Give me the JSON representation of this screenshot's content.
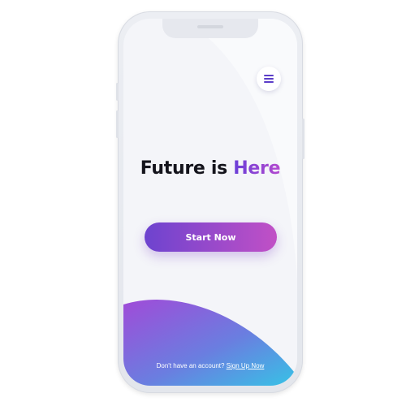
{
  "colors": {
    "accent_purple": "#6a3fd8",
    "accent_pink": "#c150c6",
    "wave_start": "#a04bd8",
    "wave_end": "#36c3e6",
    "headline_text": "#14141c"
  },
  "header": {
    "menu_icon": "hamburger-menu-icon"
  },
  "hero": {
    "headline_main": "Future is",
    "headline_accent": "Here"
  },
  "cta": {
    "start_label": "Start Now"
  },
  "footer": {
    "prompt": "Don't have an account?",
    "signup_link": "Sign Up Now"
  }
}
